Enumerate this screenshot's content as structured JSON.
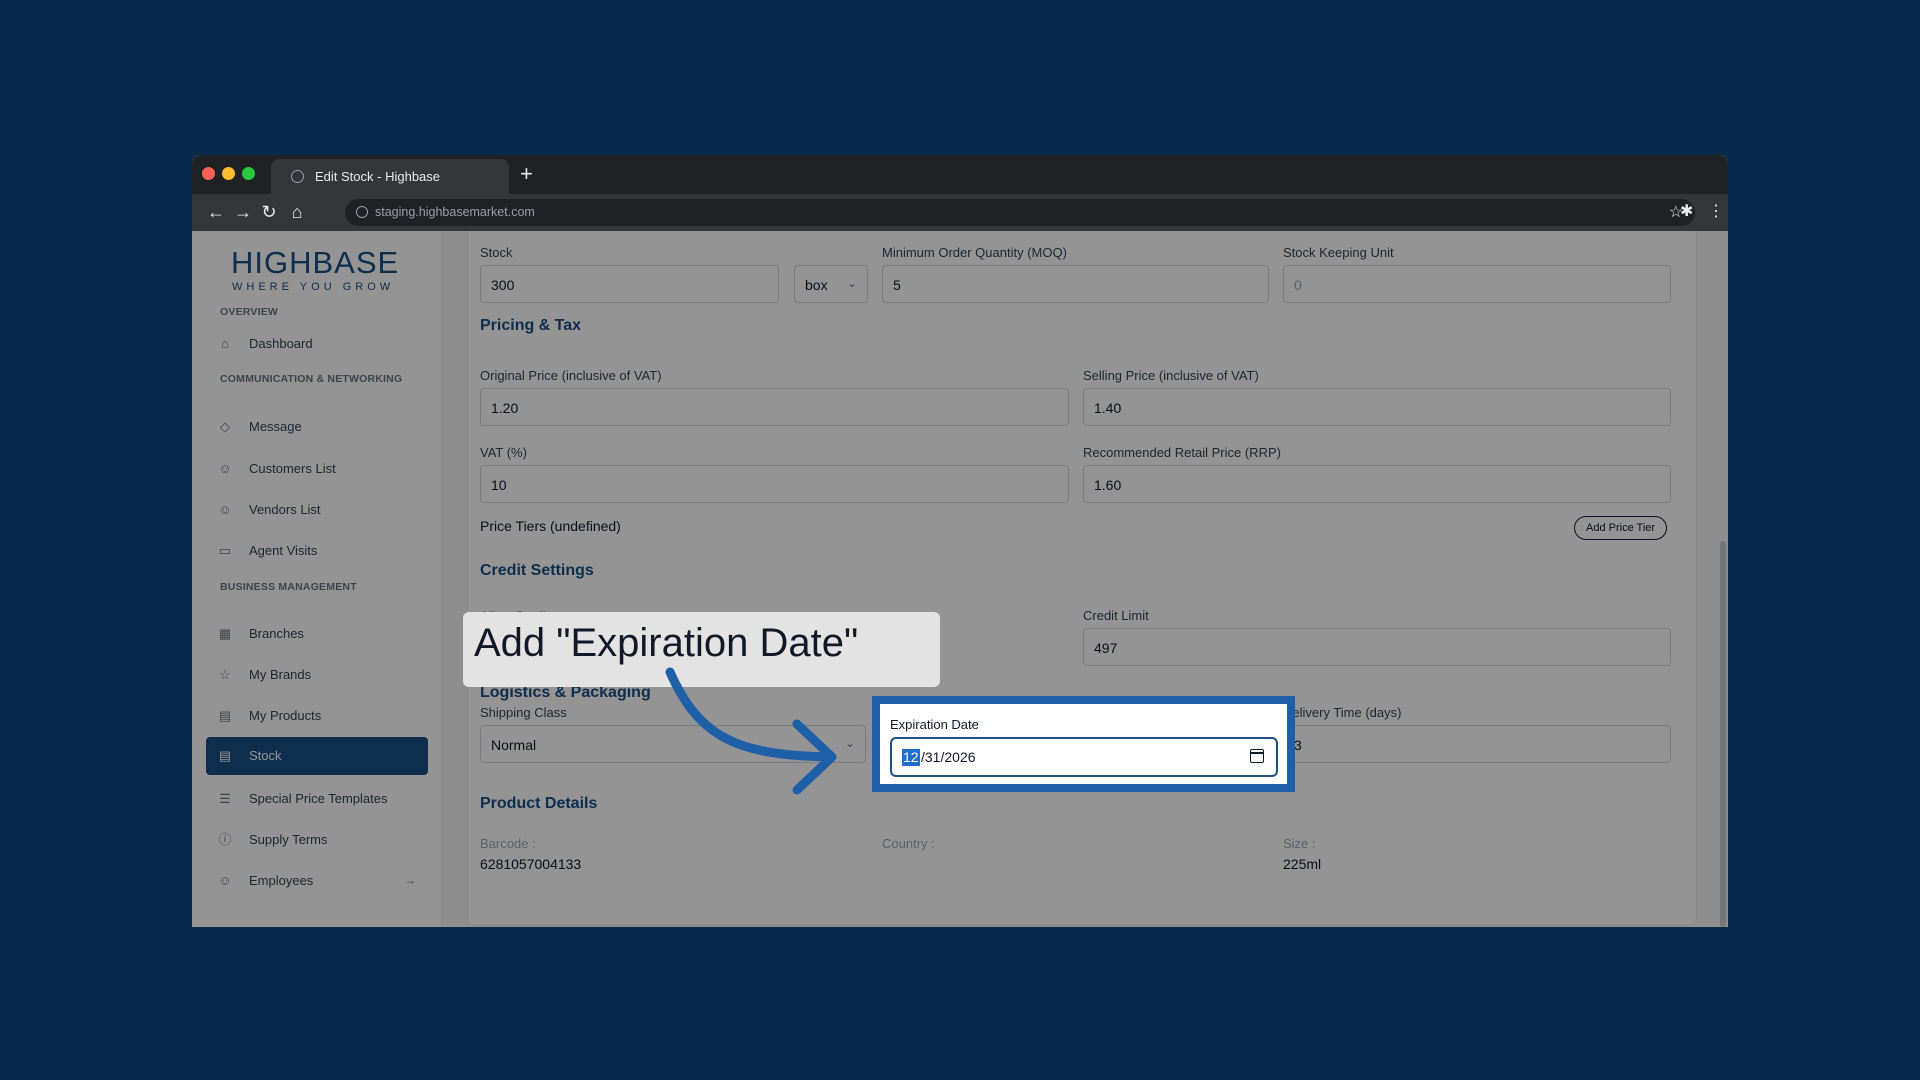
{
  "browser": {
    "tab_title": "Edit Stock - Highbase",
    "new_tab": "+",
    "url": "staging.highbasemarket.com"
  },
  "sidebar": {
    "logo_main": "HIGHBASE",
    "logo_tagline": "WHERE YOU GROW",
    "sections": {
      "overview": "OVERVIEW",
      "communication": "COMMUNICATION & NETWORKING",
      "business": "BUSINESS MANAGEMENT"
    },
    "items": [
      {
        "label": "Dashboard",
        "icon": "home-icon"
      },
      {
        "label": "Message",
        "icon": "message-icon"
      },
      {
        "label": "Customers List",
        "icon": "users-icon"
      },
      {
        "label": "Vendors List",
        "icon": "users-icon"
      },
      {
        "label": "Agent Visits",
        "icon": "truck-icon"
      },
      {
        "label": "Branches",
        "icon": "store-icon"
      },
      {
        "label": "My Brands",
        "icon": "star-icon"
      },
      {
        "label": "My Products",
        "icon": "archive-icon"
      },
      {
        "label": "Stock",
        "icon": "box-icon",
        "active": true
      },
      {
        "label": "Special Price Templates",
        "icon": "list-icon"
      },
      {
        "label": "Supply Terms",
        "icon": "info-icon"
      },
      {
        "label": "Employees",
        "icon": "users-icon"
      }
    ]
  },
  "form": {
    "stock": {
      "label": "Stock",
      "value": "300",
      "unit": "box"
    },
    "moq": {
      "label": "Minimum Order Quantity (MOQ)",
      "value": "5"
    },
    "sku": {
      "label": "Stock Keeping Unit",
      "placeholder": "0"
    },
    "pricing_heading": "Pricing & Tax",
    "original_price": {
      "label": "Original Price (inclusive of VAT)",
      "value": "1.20"
    },
    "selling_price": {
      "label": "Selling Price (inclusive of VAT)",
      "value": "1.40"
    },
    "vat": {
      "label": "VAT (%)",
      "value": "10"
    },
    "rrp": {
      "label": "Recommended Retail Price (RRP)",
      "value": "1.60"
    },
    "price_tiers": "Price Tiers (undefined)",
    "add_price_tier": "Add Price Tier",
    "credit_heading": "Credit Settings",
    "allow_credit": "Allow Credit",
    "credit_limit": {
      "label": "Credit Limit",
      "value": "497"
    },
    "logistics_heading": "Logistics & Packaging",
    "shipping_class": {
      "label": "Shipping Class",
      "value": "Normal"
    },
    "expiration_date": {
      "label": "Expiration Date",
      "selected_part": "12",
      "rest": "/31/2026"
    },
    "delivery_time": {
      "label": "Delivery Time (days)",
      "value": "3"
    },
    "product_heading": "Product Details",
    "barcode": {
      "label": "Barcode :",
      "value": "6281057004133"
    },
    "country": {
      "label": "Country :",
      "value": ""
    },
    "size": {
      "label": "Size :",
      "value": "225ml"
    }
  },
  "callout": {
    "text": "Add \"Expiration Date\""
  },
  "colors": {
    "background": "#0b2a4b",
    "brand": "#1b4f86",
    "highlight": "#1f5fa7"
  }
}
